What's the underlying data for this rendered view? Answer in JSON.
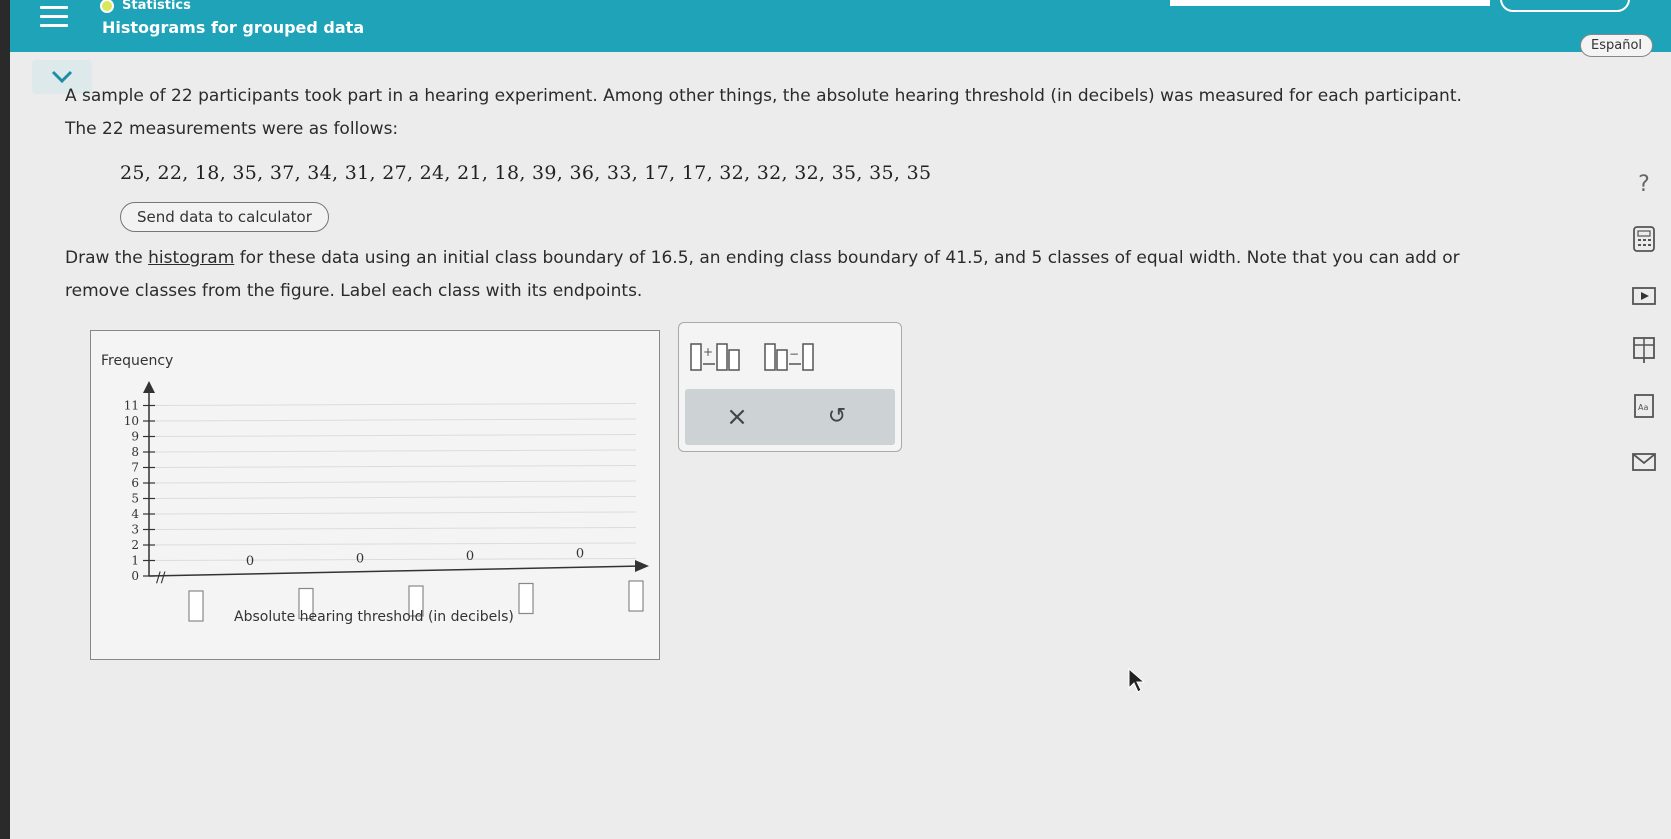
{
  "header": {
    "subject": "Statistics",
    "topic": "Histograms for grouped data",
    "language_button": "Español"
  },
  "problem": {
    "intro": "A sample of 22 participants took part in a hearing experiment. Among other things, the absolute hearing threshold (in decibels) was measured for each participant. The 22 measurements were as follows:",
    "data": "25, 22, 18, 35, 37, 34, 31, 27, 24, 21, 18, 39, 36, 33, 17, 17, 32, 32, 32, 35, 35, 35",
    "send_button": "Send data to calculator",
    "instr_before": "Draw the ",
    "instr_link": "histogram",
    "instr_after": " for these data using an initial class boundary of 16.5, an ending class boundary of 41.5, and 5 classes of equal width. Note that you can add or remove classes from the figure. Label each class with its endpoints."
  },
  "graph": {
    "ylabel": "Frequency",
    "xlabel": "Absolute hearing threshold (in decibels)",
    "y_ticks": [
      "0",
      "1",
      "2",
      "3",
      "4",
      "5",
      "6",
      "7",
      "8",
      "9",
      "10",
      "11"
    ],
    "bar_values": [
      "0",
      "0",
      "0",
      "0"
    ],
    "endpoint_boxes": 5
  },
  "tools": {
    "add_class_icon": "add-class-icon",
    "remove_class_icon": "remove-class-icon",
    "clear_icon": "×",
    "undo_icon": "↺"
  },
  "sidebar": {
    "help": "?"
  }
}
